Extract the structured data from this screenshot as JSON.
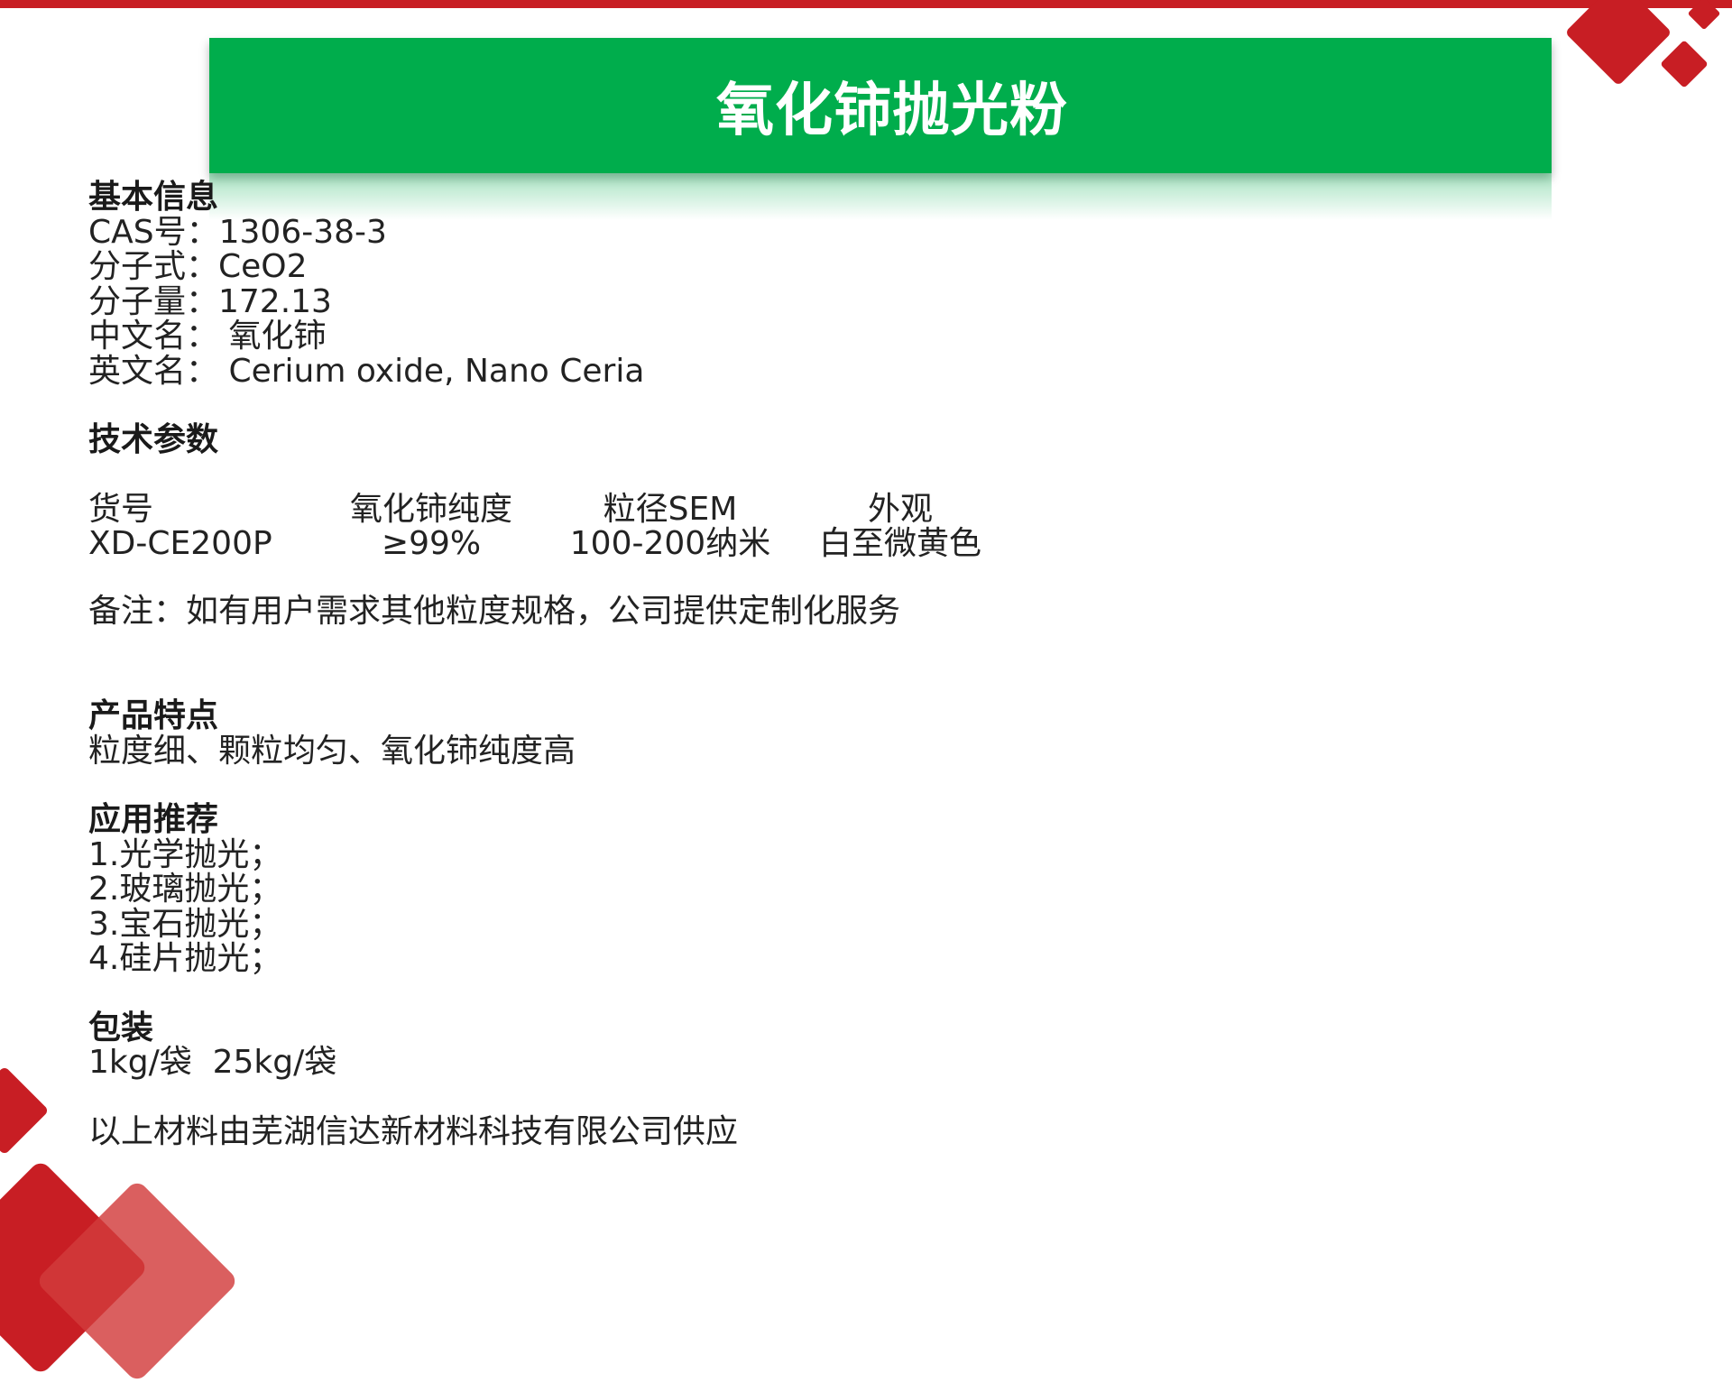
{
  "colors": {
    "accent_red": "#c81e24",
    "title_green": "#00ad4c"
  },
  "title": "氧化铈抛光粉",
  "basic_info": {
    "heading": "基本信息",
    "lines": [
      "CAS号：1306-38-3",
      "分子式：CeO2",
      "分子量：172.13",
      "中文名： 氧化铈",
      "英文名： Cerium oxide, Nano Ceria"
    ]
  },
  "tech_params": {
    "heading": "技术参数",
    "headers": [
      "货号",
      "氧化铈纯度",
      "粒径SEM",
      "外观"
    ],
    "row": [
      "XD-CE200P",
      "≥99%",
      "100-200纳米",
      "白至微黄色"
    ],
    "note": "备注：如有用户需求其他粒度规格，公司提供定制化服务"
  },
  "features": {
    "heading": "产品特点",
    "text": "粒度细、颗粒均匀、氧化铈纯度高"
  },
  "applications": {
    "heading": "应用推荐",
    "items": [
      "1.光学抛光；",
      "2.玻璃抛光；",
      "3.宝石抛光；",
      "4.硅片抛光；"
    ]
  },
  "packaging": {
    "heading": "包装",
    "text": "1kg/袋  25kg/袋"
  },
  "supplier": "以上材料由芜湖信达新材料科技有限公司供应"
}
